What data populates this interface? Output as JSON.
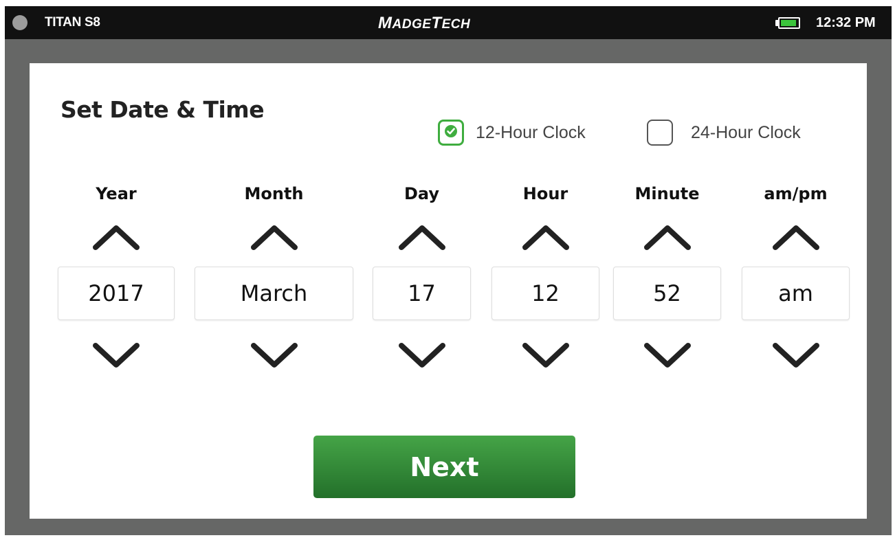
{
  "status_bar": {
    "device_name": "TITAN S8",
    "brand_first_big": "M",
    "brand_first_small": "ADGE",
    "brand_second_big": "T",
    "brand_second_small": "ECH",
    "time": "12:32 PM",
    "battery_level": 0.9,
    "battery_color": "#3cc43c"
  },
  "screen": {
    "title": "Set Date & Time",
    "clock_formats": [
      {
        "label": "12-Hour Clock",
        "checked": true
      },
      {
        "label": "24-Hour Clock",
        "checked": false
      }
    ],
    "fields": [
      {
        "label": "Year",
        "value": "2017"
      },
      {
        "label": "Month",
        "value": "March"
      },
      {
        "label": "Day",
        "value": "17"
      },
      {
        "label": "Hour",
        "value": "12"
      },
      {
        "label": "Minute",
        "value": "52"
      },
      {
        "label": "am/pm",
        "value": "am"
      }
    ],
    "next_label": "Next",
    "accent_color": "#3fad3f"
  }
}
